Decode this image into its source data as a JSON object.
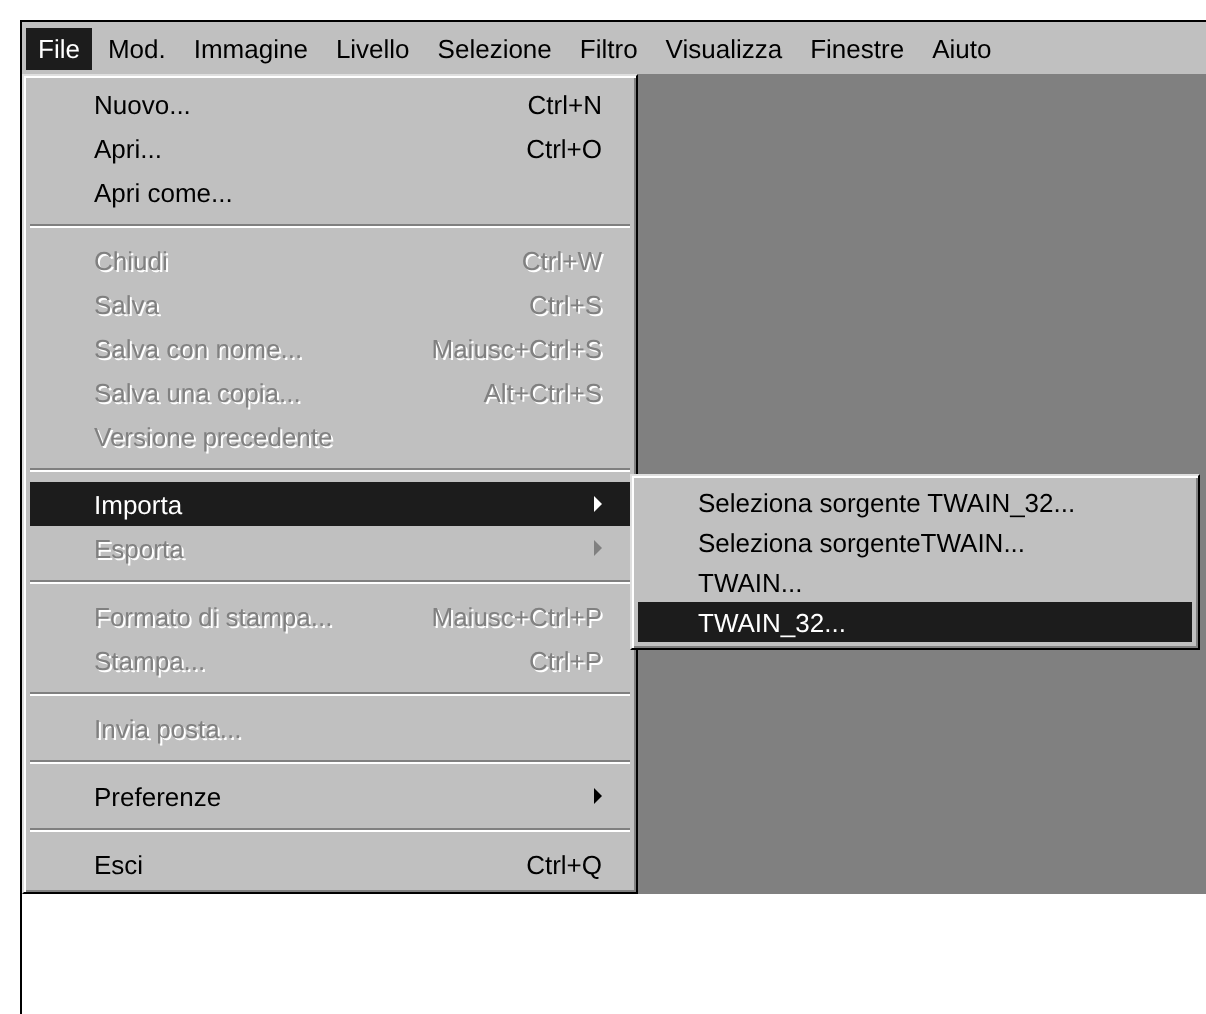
{
  "menu_bar": [
    {
      "label": "File",
      "selected": true
    },
    {
      "label": "Mod.",
      "selected": false
    },
    {
      "label": "Immagine",
      "selected": false
    },
    {
      "label": "Livello",
      "selected": false
    },
    {
      "label": "Selezione",
      "selected": false
    },
    {
      "label": "Filtro",
      "selected": false
    },
    {
      "label": "Visualizza",
      "selected": false
    },
    {
      "label": "Finestre",
      "selected": false
    },
    {
      "label": "Aiuto",
      "selected": false
    }
  ],
  "file_menu": {
    "items": [
      {
        "kind": "item",
        "label": "Nuovo...",
        "shortcut": "Ctrl+N",
        "disabled": false,
        "selected": false
      },
      {
        "kind": "item",
        "label": "Apri...",
        "shortcut": "Ctrl+O",
        "disabled": false,
        "selected": false
      },
      {
        "kind": "item",
        "label": "Apri come...",
        "disabled": false,
        "selected": false
      },
      {
        "kind": "separator"
      },
      {
        "kind": "item",
        "label": "Chiudi",
        "shortcut": "Ctrl+W",
        "disabled": true,
        "selected": false
      },
      {
        "kind": "item",
        "label": "Salva",
        "shortcut": "Ctrl+S",
        "disabled": true,
        "selected": false
      },
      {
        "kind": "item",
        "label": "Salva con nome...",
        "shortcut": "Maiusc+Ctrl+S",
        "disabled": true,
        "selected": false
      },
      {
        "kind": "item",
        "label": "Salva una copia...",
        "shortcut": "Alt+Ctrl+S",
        "disabled": true,
        "selected": false
      },
      {
        "kind": "item",
        "label": "Versione precedente",
        "disabled": true,
        "selected": false
      },
      {
        "kind": "separator"
      },
      {
        "kind": "submenu",
        "label": "Importa",
        "disabled": false,
        "selected": true
      },
      {
        "kind": "submenu",
        "label": "Esporta",
        "disabled": true,
        "selected": false
      },
      {
        "kind": "separator"
      },
      {
        "kind": "item",
        "label": "Formato di stampa...",
        "shortcut": "Maiusc+Ctrl+P",
        "disabled": true,
        "selected": false
      },
      {
        "kind": "item",
        "label": "Stampa...",
        "shortcut": "Ctrl+P",
        "disabled": true,
        "selected": false
      },
      {
        "kind": "separator"
      },
      {
        "kind": "item",
        "label": "Invia posta...",
        "disabled": true,
        "selected": false
      },
      {
        "kind": "separator"
      },
      {
        "kind": "submenu",
        "label": "Preferenze",
        "disabled": false,
        "selected": false
      },
      {
        "kind": "separator"
      },
      {
        "kind": "item",
        "label": "Esci",
        "shortcut": "Ctrl+Q",
        "disabled": false,
        "selected": false
      }
    ]
  },
  "import_submenu": {
    "items": [
      {
        "label": "Seleziona sorgente TWAIN_32...",
        "selected": false
      },
      {
        "label": "Seleziona sorgenteTWAIN...",
        "selected": false
      },
      {
        "label": "TWAIN...",
        "selected": false
      },
      {
        "label": "TWAIN_32...",
        "selected": true
      }
    ]
  }
}
